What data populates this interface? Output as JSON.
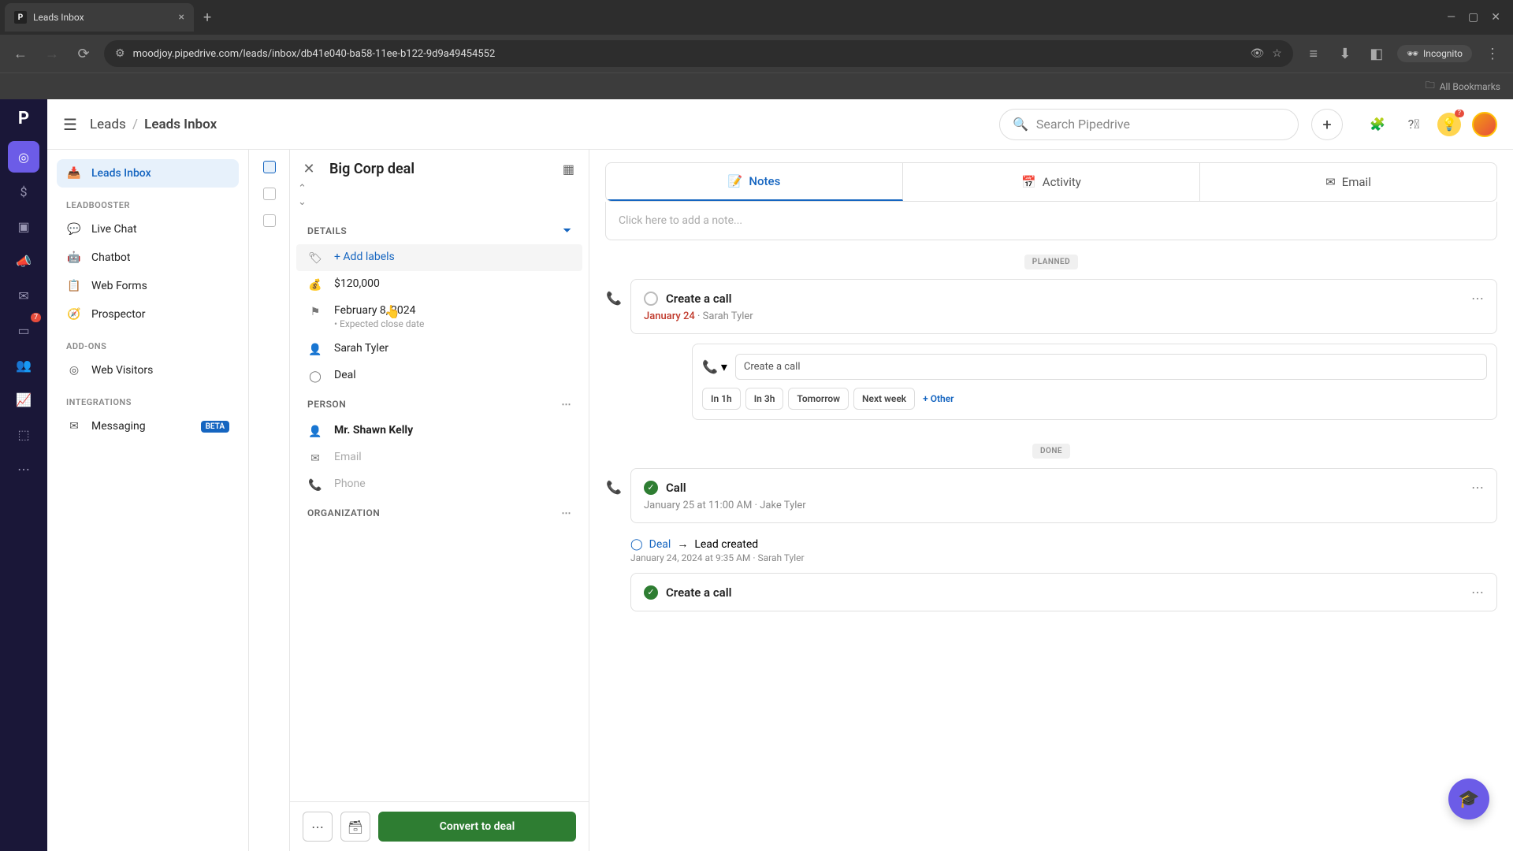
{
  "browser": {
    "tab_title": "Leads Inbox",
    "url": "moodjoy.pipedrive.com/leads/inbox/db41e040-ba58-11ee-b122-9d9a49454552",
    "incognito": "Incognito",
    "all_bookmarks": "All Bookmarks"
  },
  "topbar": {
    "breadcrumb_root": "Leads",
    "breadcrumb_current": "Leads Inbox",
    "search_placeholder": "Search Pipedrive"
  },
  "sidebar": {
    "inbox": "Leads Inbox",
    "heading_leadbooster": "LEADBOOSTER",
    "live_chat": "Live Chat",
    "chatbot": "Chatbot",
    "web_forms": "Web Forms",
    "prospector": "Prospector",
    "heading_addons": "ADD-ONS",
    "web_visitors": "Web Visitors",
    "heading_integrations": "INTEGRATIONS",
    "messaging": "Messaging",
    "beta": "BETA"
  },
  "rail": {
    "badge": "7"
  },
  "detail": {
    "title": "Big Corp deal",
    "heading_details": "DETAILS",
    "add_labels": "+ Add labels",
    "value": "$120,000",
    "close_date": "February 8, 2024",
    "close_date_sub": "Expected close date",
    "owner": "Sarah Tyler",
    "type": "Deal",
    "heading_person": "PERSON",
    "person_name": "Mr. Shawn Kelly",
    "person_email_ph": "Email",
    "person_phone_ph": "Phone",
    "heading_org": "ORGANIZATION",
    "convert": "Convert to deal"
  },
  "tabs": {
    "notes": "Notes",
    "activity": "Activity",
    "email": "Email"
  },
  "note_placeholder": "Click here to add a note...",
  "timeline": {
    "planned": "PLANNED",
    "done": "DONE",
    "planned_card": {
      "title": "Create a call",
      "date": "January 24",
      "owner": "Sarah Tyler"
    },
    "quick": {
      "input": "Create a call",
      "b1": "In 1h",
      "b2": "In 3h",
      "b3": "Tomorrow",
      "b4": "Next week",
      "other": "+ Other"
    },
    "done_card": {
      "title": "Call",
      "meta": "January 25 at 11:00 AM · Jake Tyler"
    },
    "event": {
      "deal": "Deal",
      "text": "Lead created",
      "meta": "January 24, 2024 at 9:35 AM · Sarah Tyler"
    },
    "done_card2": {
      "title": "Create a call"
    }
  },
  "bulb_badge": "?"
}
